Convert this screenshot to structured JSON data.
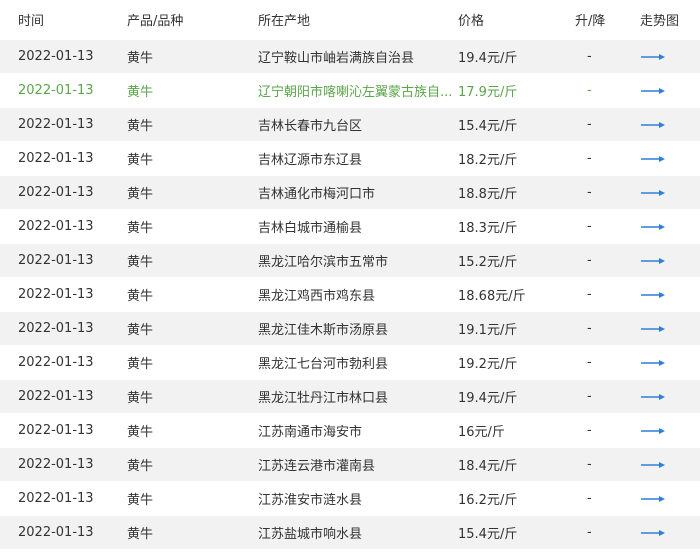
{
  "headers": {
    "time": "时间",
    "product": "产品/品种",
    "origin": "所在产地",
    "price": "价格",
    "change": "升/降",
    "trend": "走势图"
  },
  "colors": {
    "highlight_text": "#5aa64a",
    "arrow": "#2f7fd8",
    "stripe": "#f2f2f2"
  },
  "rows": [
    {
      "date": "2022-01-13",
      "product": "黄牛",
      "origin": "辽宁鞍山市岫岩满族自治县",
      "price": "19.4元/斤",
      "change": "-",
      "trend_icon": "arrow-right-icon"
    },
    {
      "date": "2022-01-13",
      "product": "黄牛",
      "origin": "辽宁朝阳市喀喇沁左翼蒙古族自...",
      "price": "17.9元/斤",
      "change": "-",
      "trend_icon": "arrow-right-icon"
    },
    {
      "date": "2022-01-13",
      "product": "黄牛",
      "origin": "吉林长春市九台区",
      "price": "15.4元/斤",
      "change": "-",
      "trend_icon": "arrow-right-icon"
    },
    {
      "date": "2022-01-13",
      "product": "黄牛",
      "origin": "吉林辽源市东辽县",
      "price": "18.2元/斤",
      "change": "-",
      "trend_icon": "arrow-right-icon"
    },
    {
      "date": "2022-01-13",
      "product": "黄牛",
      "origin": "吉林通化市梅河口市",
      "price": "18.8元/斤",
      "change": "-",
      "trend_icon": "arrow-right-icon"
    },
    {
      "date": "2022-01-13",
      "product": "黄牛",
      "origin": "吉林白城市通榆县",
      "price": "18.3元/斤",
      "change": "-",
      "trend_icon": "arrow-right-icon"
    },
    {
      "date": "2022-01-13",
      "product": "黄牛",
      "origin": "黑龙江哈尔滨市五常市",
      "price": "15.2元/斤",
      "change": "-",
      "trend_icon": "arrow-right-icon"
    },
    {
      "date": "2022-01-13",
      "product": "黄牛",
      "origin": "黑龙江鸡西市鸡东县",
      "price": "18.68元/斤",
      "change": "-",
      "trend_icon": "arrow-right-icon"
    },
    {
      "date": "2022-01-13",
      "product": "黄牛",
      "origin": "黑龙江佳木斯市汤原县",
      "price": "19.1元/斤",
      "change": "-",
      "trend_icon": "arrow-right-icon"
    },
    {
      "date": "2022-01-13",
      "product": "黄牛",
      "origin": "黑龙江七台河市勃利县",
      "price": "19.2元/斤",
      "change": "-",
      "trend_icon": "arrow-right-icon"
    },
    {
      "date": "2022-01-13",
      "product": "黄牛",
      "origin": "黑龙江牡丹江市林口县",
      "price": "19.4元/斤",
      "change": "-",
      "trend_icon": "arrow-right-icon"
    },
    {
      "date": "2022-01-13",
      "product": "黄牛",
      "origin": "江苏南通市海安市",
      "price": "16元/斤",
      "change": "-",
      "trend_icon": "arrow-right-icon"
    },
    {
      "date": "2022-01-13",
      "product": "黄牛",
      "origin": "江苏连云港市灌南县",
      "price": "18.4元/斤",
      "change": "-",
      "trend_icon": "arrow-right-icon"
    },
    {
      "date": "2022-01-13",
      "product": "黄牛",
      "origin": "江苏淮安市涟水县",
      "price": "16.2元/斤",
      "change": "-",
      "trend_icon": "arrow-right-icon"
    },
    {
      "date": "2022-01-13",
      "product": "黄牛",
      "origin": "江苏盐城市响水县",
      "price": "15.4元/斤",
      "change": "-",
      "trend_icon": "arrow-right-icon"
    }
  ]
}
